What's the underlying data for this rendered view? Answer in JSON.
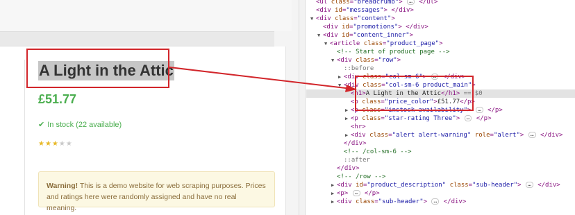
{
  "product_page": {
    "title": "A Light in the Attic",
    "price": "£51.77",
    "stock_text": "In stock (22 available)",
    "rating": 3,
    "rating_max": 5,
    "warning_strong": "Warning!",
    "warning_text": " This is a demo website for web scraping purposes. Prices and ratings here were randomly assigned and have no real meaning."
  },
  "colors": {
    "price_green": "#4bae4f",
    "star_on": "#e8b929",
    "star_off": "#c9c9c9",
    "annotation_red": "#d2262b",
    "tag_purple": "#881280",
    "attr_name": "#994500",
    "attr_value": "#1a1aa6",
    "comment_green": "#236e25"
  },
  "devtools": {
    "divider_dots": "...",
    "nodes": [
      {
        "depth": 0,
        "tri": "",
        "parts": [
          [
            "tag",
            "<ul "
          ],
          [
            "an",
            "class"
          ],
          [
            "tag",
            "="
          ],
          [
            "av",
            "\"breadcrumb\""
          ],
          [
            "tag",
            "> "
          ],
          [
            "ell",
            "…"
          ],
          [
            "tag",
            " </ul>"
          ]
        ]
      },
      {
        "depth": 0,
        "tri": "",
        "parts": [
          [
            "tag",
            "<div "
          ],
          [
            "an",
            "id"
          ],
          [
            "tag",
            "="
          ],
          [
            "av",
            "\"messages\""
          ],
          [
            "tag",
            "> </div>"
          ]
        ]
      },
      {
        "depth": 0,
        "tri": "▼",
        "parts": [
          [
            "tag",
            "<div "
          ],
          [
            "an",
            "class"
          ],
          [
            "tag",
            "="
          ],
          [
            "av",
            "\"content\""
          ],
          [
            "tag",
            ">"
          ]
        ]
      },
      {
        "depth": 1,
        "tri": "",
        "parts": [
          [
            "tag",
            "<div "
          ],
          [
            "an",
            "id"
          ],
          [
            "tag",
            "="
          ],
          [
            "av",
            "\"promotions\""
          ],
          [
            "tag",
            "> </div>"
          ]
        ]
      },
      {
        "depth": 1,
        "tri": "▼",
        "parts": [
          [
            "tag",
            "<div "
          ],
          [
            "an",
            "id"
          ],
          [
            "tag",
            "="
          ],
          [
            "av",
            "\"content_inner\""
          ],
          [
            "tag",
            ">"
          ]
        ]
      },
      {
        "depth": 2,
        "tri": "▼",
        "parts": [
          [
            "tag",
            "<article "
          ],
          [
            "an",
            "class"
          ],
          [
            "tag",
            "="
          ],
          [
            "av",
            "\"product_page\""
          ],
          [
            "tag",
            ">"
          ]
        ]
      },
      {
        "depth": 3,
        "tri": "",
        "parts": [
          [
            "cm",
            "<!-- Start of product page -->"
          ]
        ]
      },
      {
        "depth": 3,
        "tri": "▼",
        "parts": [
          [
            "tag",
            "<div "
          ],
          [
            "an",
            "class"
          ],
          [
            "tag",
            "="
          ],
          [
            "av",
            "\"row\""
          ],
          [
            "tag",
            ">"
          ]
        ]
      },
      {
        "depth": 4,
        "tri": "",
        "parts": [
          [
            "ps",
            "::before"
          ]
        ]
      },
      {
        "depth": 4,
        "tri": "▶",
        "parts": [
          [
            "tag",
            "<div "
          ],
          [
            "an",
            "class"
          ],
          [
            "tag",
            "="
          ],
          [
            "av",
            "\"col-sm-6\""
          ],
          [
            "tag",
            "> "
          ],
          [
            "ell",
            "…"
          ],
          [
            "tag",
            " </div>"
          ]
        ]
      },
      {
        "depth": 4,
        "tri": "▼",
        "parts": [
          [
            "tag",
            "<div "
          ],
          [
            "an",
            "class"
          ],
          [
            "tag",
            "="
          ],
          [
            "av",
            "\"col-sm-6 product_main\""
          ],
          [
            "tag",
            ">"
          ]
        ]
      },
      {
        "depth": 5,
        "tri": "",
        "selected": true,
        "parts": [
          [
            "tag",
            "<h1>"
          ],
          [
            "tx",
            "A Light in the Attic"
          ],
          [
            "tag",
            "</h1>"
          ],
          [
            "ps",
            " == $0"
          ]
        ]
      },
      {
        "depth": 5,
        "tri": "",
        "parts": [
          [
            "tag",
            "<p "
          ],
          [
            "an",
            "class"
          ],
          [
            "tag",
            "="
          ],
          [
            "av",
            "\"price_color\""
          ],
          [
            "tag",
            ">"
          ],
          [
            "tx",
            "£51.77"
          ],
          [
            "tag",
            "</p>"
          ]
        ]
      },
      {
        "depth": 5,
        "tri": "▶",
        "parts": [
          [
            "tag",
            "<p "
          ],
          [
            "an",
            "class"
          ],
          [
            "tag",
            "="
          ],
          [
            "av",
            "\"instock availability\""
          ],
          [
            "tag",
            "> "
          ],
          [
            "ell",
            "…"
          ],
          [
            "tag",
            " </p>"
          ]
        ]
      },
      {
        "depth": 5,
        "tri": "▶",
        "parts": [
          [
            "tag",
            "<p "
          ],
          [
            "an",
            "class"
          ],
          [
            "tag",
            "="
          ],
          [
            "av",
            "\"star-rating Three\""
          ],
          [
            "tag",
            "> "
          ],
          [
            "ell",
            "…"
          ],
          [
            "tag",
            " </p>"
          ]
        ]
      },
      {
        "depth": 5,
        "tri": "",
        "parts": [
          [
            "tag",
            "<hr>"
          ]
        ]
      },
      {
        "depth": 5,
        "tri": "▶",
        "parts": [
          [
            "tag",
            "<div "
          ],
          [
            "an",
            "class"
          ],
          [
            "tag",
            "="
          ],
          [
            "av",
            "\"alert alert-warning\""
          ],
          [
            "tag",
            " "
          ],
          [
            "an",
            "role"
          ],
          [
            "tag",
            "="
          ],
          [
            "av",
            "\"alert\""
          ],
          [
            "tag",
            "> "
          ],
          [
            "ell",
            "…"
          ],
          [
            "tag",
            " </div>"
          ]
        ]
      },
      {
        "depth": 4,
        "tri": "",
        "parts": [
          [
            "tag",
            "</div>"
          ]
        ]
      },
      {
        "depth": 4,
        "tri": "",
        "parts": [
          [
            "cm",
            "<!-- /col-sm-6 -->"
          ]
        ]
      },
      {
        "depth": 4,
        "tri": "",
        "parts": [
          [
            "ps",
            "::after"
          ]
        ]
      },
      {
        "depth": 3,
        "tri": "",
        "parts": [
          [
            "tag",
            "</div>"
          ]
        ]
      },
      {
        "depth": 3,
        "tri": "",
        "parts": [
          [
            "cm",
            "<!-- /row -->"
          ]
        ]
      },
      {
        "depth": 3,
        "tri": "▶",
        "parts": [
          [
            "tag",
            "<div "
          ],
          [
            "an",
            "id"
          ],
          [
            "tag",
            "="
          ],
          [
            "av",
            "\"product_description\""
          ],
          [
            "tag",
            " "
          ],
          [
            "an",
            "class"
          ],
          [
            "tag",
            "="
          ],
          [
            "av",
            "\"sub-header\""
          ],
          [
            "tag",
            "> "
          ],
          [
            "ell",
            "…"
          ],
          [
            "tag",
            " </div>"
          ]
        ]
      },
      {
        "depth": 3,
        "tri": "▶",
        "parts": [
          [
            "tag",
            "<p> "
          ],
          [
            "ell",
            "…"
          ],
          [
            "tag",
            " </p>"
          ]
        ]
      },
      {
        "depth": 3,
        "tri": "▶",
        "parts": [
          [
            "tag",
            "<div "
          ],
          [
            "an",
            "class"
          ],
          [
            "tag",
            "="
          ],
          [
            "av",
            "\"sub-header\""
          ],
          [
            "tag",
            "> "
          ],
          [
            "ell",
            "…"
          ],
          [
            "tag",
            " </div>"
          ]
        ]
      }
    ]
  }
}
